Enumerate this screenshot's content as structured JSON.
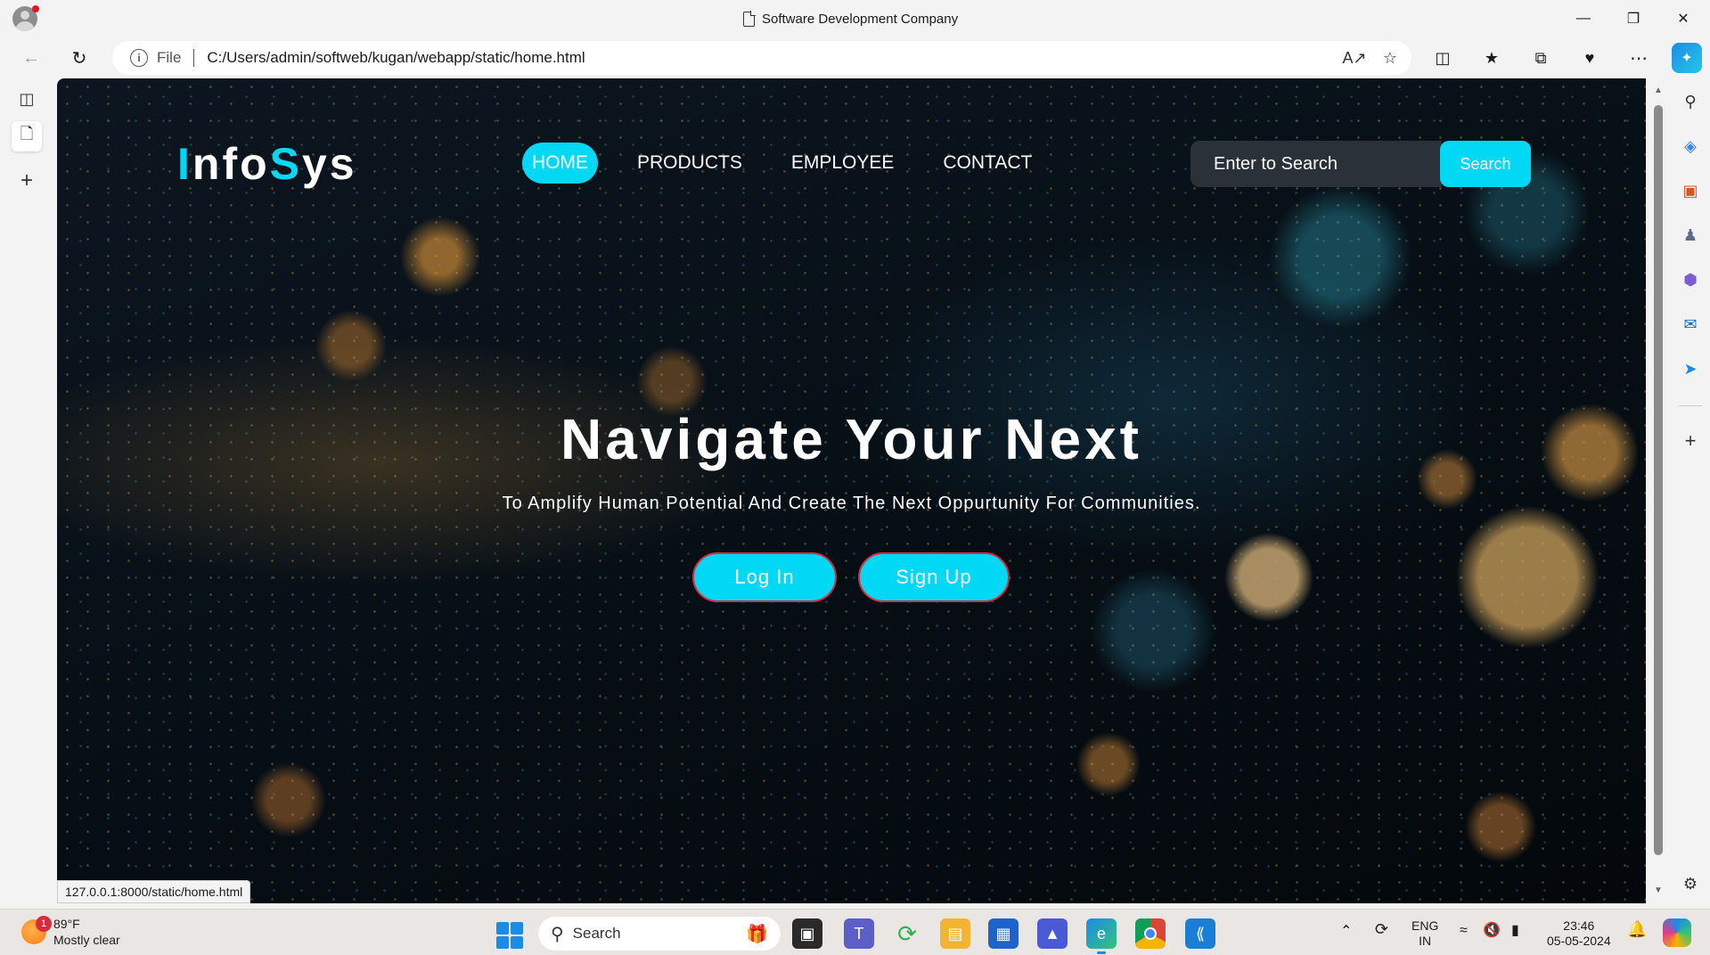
{
  "browser": {
    "tab_title": "Software Development Company",
    "address_scheme": "File",
    "address_url": "C:/Users/admin/softweb/kugan/webapp/static/home.html",
    "status_url": "127.0.0.1:8000/static/home.html"
  },
  "site": {
    "logo": {
      "part1": "I",
      "part2": "nfo",
      "part3": "S",
      "part4": "ys"
    },
    "nav": [
      {
        "label": "HOME",
        "active": true
      },
      {
        "label": "PRODUCTS",
        "active": false
      },
      {
        "label": "EMPLOYEE",
        "active": false
      },
      {
        "label": "CONTACT",
        "active": false
      }
    ],
    "search": {
      "placeholder": "Enter to Search",
      "button_label": "Search"
    },
    "hero": {
      "title": "Navigate Your Next",
      "subtitle": "To Amplify Human Potential And Create The Next Oppurtunity For Communities.",
      "login_label": "Log In",
      "signup_label": "Sign Up"
    },
    "colors": {
      "accent": "#00d8f5",
      "button_border": "#d62d3c",
      "search_bg": "#2a3138"
    }
  },
  "taskbar": {
    "weather": {
      "temp": "89°F",
      "condition": "Mostly clear",
      "badge": "1"
    },
    "search_label": "Search",
    "language": {
      "line1": "ENG",
      "line2": "IN"
    },
    "clock": {
      "time": "23:46",
      "date": "05-05-2024"
    }
  }
}
